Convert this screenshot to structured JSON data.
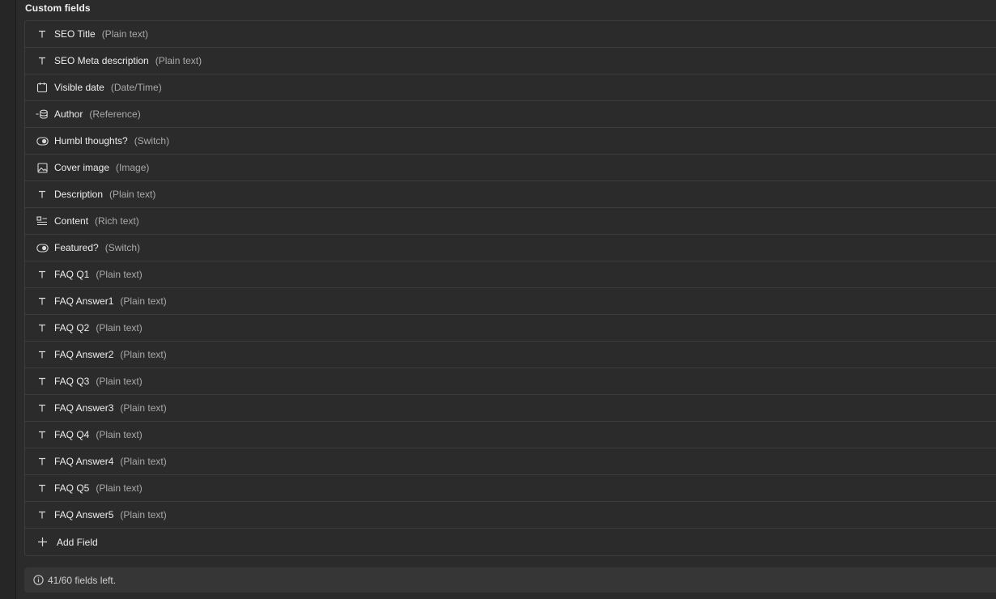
{
  "section": {
    "title": "Custom fields"
  },
  "fields": [
    {
      "name": "SEO Title",
      "type": "(Plain text)",
      "icon": "text-icon"
    },
    {
      "name": "SEO Meta description",
      "type": "(Plain text)",
      "icon": "text-icon"
    },
    {
      "name": "Visible date",
      "type": "(Date/Time)",
      "icon": "calendar-icon"
    },
    {
      "name": "Author",
      "type": "(Reference)",
      "icon": "reference-icon"
    },
    {
      "name": "Humbl thoughts?",
      "type": "(Switch)",
      "icon": "switch-icon"
    },
    {
      "name": "Cover image",
      "type": "(Image)",
      "icon": "image-icon"
    },
    {
      "name": "Description",
      "type": "(Plain text)",
      "icon": "text-icon"
    },
    {
      "name": "Content",
      "type": "(Rich text)",
      "icon": "rich-text-icon"
    },
    {
      "name": "Featured?",
      "type": "(Switch)",
      "icon": "switch-icon"
    },
    {
      "name": "FAQ Q1",
      "type": "(Plain text)",
      "icon": "text-icon"
    },
    {
      "name": "FAQ Answer1",
      "type": "(Plain text)",
      "icon": "text-icon"
    },
    {
      "name": "FAQ Q2",
      "type": "(Plain text)",
      "icon": "text-icon"
    },
    {
      "name": "FAQ Answer2",
      "type": "(Plain text)",
      "icon": "text-icon"
    },
    {
      "name": "FAQ Q3",
      "type": "(Plain text)",
      "icon": "text-icon"
    },
    {
      "name": "FAQ Answer3",
      "type": "(Plain text)",
      "icon": "text-icon"
    },
    {
      "name": "FAQ Q4",
      "type": "(Plain text)",
      "icon": "text-icon"
    },
    {
      "name": "FAQ Answer4",
      "type": "(Plain text)",
      "icon": "text-icon"
    },
    {
      "name": "FAQ Q5",
      "type": "(Plain text)",
      "icon": "text-icon"
    },
    {
      "name": "FAQ Answer5",
      "type": "(Plain text)",
      "icon": "text-icon"
    }
  ],
  "add_field": {
    "label": "Add Field",
    "icon": "plus-icon"
  },
  "info": {
    "text": "41/60 fields left.",
    "icon": "info-icon"
  },
  "colors": {
    "background": "#2b2b2b",
    "border": "#3d3d3d",
    "text": "#ededed",
    "muted": "#a9a9a9",
    "info_bar": "#363636"
  }
}
